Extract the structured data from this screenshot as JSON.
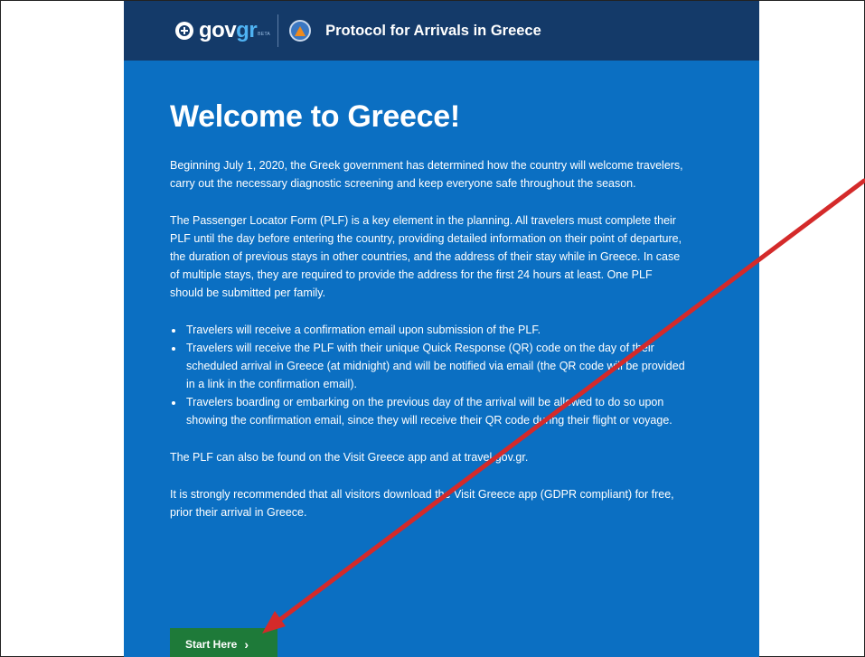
{
  "header": {
    "logo_main": "gov",
    "logo_accent": "gr",
    "logo_badge": "BETA",
    "title": "Protocol for Arrivals in Greece"
  },
  "main": {
    "heading": "Welcome to Greece!",
    "paragraphs": [
      "Beginning July 1, 2020, the Greek government has determined how the country will welcome travelers, carry out the necessary diagnostic screening and keep everyone safe throughout the season.",
      "The Passenger Locator Form (PLF) is a key element in the planning. All travelers must complete their PLF until the day before entering the country, providing detailed information on their point of departure, the duration of previous stays in other countries, and the address of their stay while in Greece. In case of multiple stays, they are required to provide the address for the first 24 hours at least. One PLF should be submitted per family."
    ],
    "bullets": [
      "Travelers will receive a confirmation email upon submission of the PLF.",
      "Travelers will receive the PLF with their unique Quick Response (QR) code on the day of their scheduled arrival in Greece (at midnight) and will be notified via email (the QR code will be provided in a link in the confirmation email).",
      "Travelers boarding or embarking on the previous day of the arrival will be allowed to do so upon showing the confirmation email, since they will receive their QR code during their flight or voyage."
    ],
    "closing_paragraphs": [
      "The PLF can also be found on the Visit Greece app and at travel.gov.gr.",
      "It is strongly recommended that all visitors download the Visit Greece app (GDPR compliant) for free, prior their arrival in Greece."
    ],
    "start_button": "Start Here",
    "start_chevron": "›"
  },
  "colors": {
    "page_background": "#0b6fc2",
    "header_background": "#143a69",
    "button_background": "#1e7a39",
    "annotation_arrow": "#d42a2a"
  },
  "icons": {
    "emblem": "greek-emblem-icon",
    "civil_protection": "civil-protection-icon",
    "chevron": "chevron-right-icon",
    "annotation": "red-arrow-annotation"
  }
}
